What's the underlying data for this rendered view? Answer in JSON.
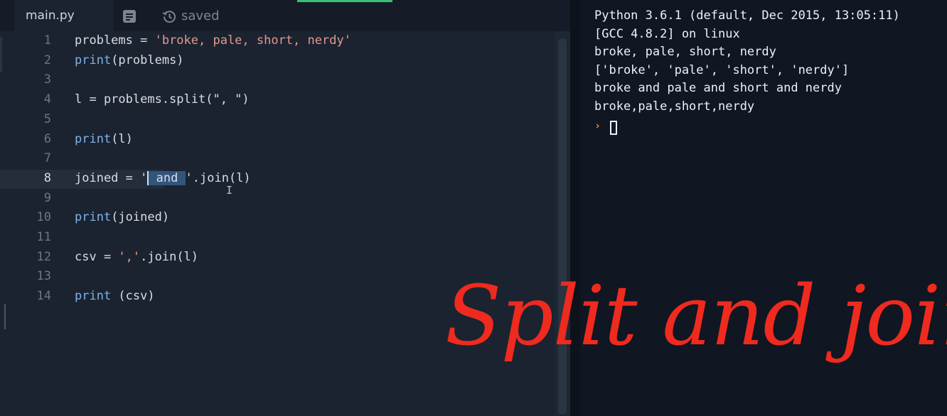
{
  "editor": {
    "tab_filename": "main.py",
    "notes_icon": "notes-icon",
    "saved_icon": "history-icon",
    "saved_label": "saved",
    "active_line": 8,
    "lines": [
      {
        "number": "1",
        "segments": [
          {
            "text": "problems = ",
            "kind": "plain"
          },
          {
            "text": "'broke, pale, short, nerdy'",
            "kind": "str"
          }
        ]
      },
      {
        "number": "2",
        "segments": [
          {
            "text": "print",
            "kind": "kw"
          },
          {
            "text": "(problems)",
            "kind": "plain"
          }
        ]
      },
      {
        "number": "3",
        "segments": []
      },
      {
        "number": "4",
        "segments": [
          {
            "text": "l = problems.split(\", \")",
            "kind": "plain"
          }
        ]
      },
      {
        "number": "5",
        "segments": []
      },
      {
        "number": "6",
        "segments": [
          {
            "text": "print",
            "kind": "kw"
          },
          {
            "text": "(l)",
            "kind": "plain"
          }
        ]
      },
      {
        "number": "7",
        "segments": []
      },
      {
        "number": "8",
        "segments": [
          {
            "text": "joined = '",
            "kind": "plain"
          },
          {
            "text": " and ",
            "kind": "sel"
          },
          {
            "text": "'.join(l)",
            "kind": "plain"
          }
        ]
      },
      {
        "number": "9",
        "segments": []
      },
      {
        "number": "10",
        "segments": [
          {
            "text": "print",
            "kind": "kw"
          },
          {
            "text": "(joined)",
            "kind": "plain"
          }
        ]
      },
      {
        "number": "11",
        "segments": []
      },
      {
        "number": "12",
        "segments": [
          {
            "text": "csv = ",
            "kind": "plain"
          },
          {
            "text": "','",
            "kind": "str"
          },
          {
            "text": ".join(l)",
            "kind": "plain"
          }
        ]
      },
      {
        "number": "13",
        "segments": []
      },
      {
        "number": "14",
        "segments": [
          {
            "text": "print",
            "kind": "kw"
          },
          {
            "text": " (csv)",
            "kind": "plain"
          }
        ]
      }
    ],
    "text_cursor_glyph": "I"
  },
  "console": {
    "lines": [
      "Python 3.6.1 (default, Dec 2015, 13:05:11)",
      "[GCC 4.8.2] on linux",
      "broke, pale, short, nerdy",
      "['broke', 'pale', 'short', 'nerdy']",
      "broke and pale and short and nerdy",
      "broke,pale,short,nerdy"
    ],
    "prompt_symbol": "›"
  },
  "overlay": {
    "caption": "Split and join"
  },
  "colors": {
    "keyword": "#7fb2e8",
    "string": "#e39a8d",
    "caption": "#ef2a1f",
    "prompt": "#e8874a",
    "saved_progress": "#38c172"
  }
}
